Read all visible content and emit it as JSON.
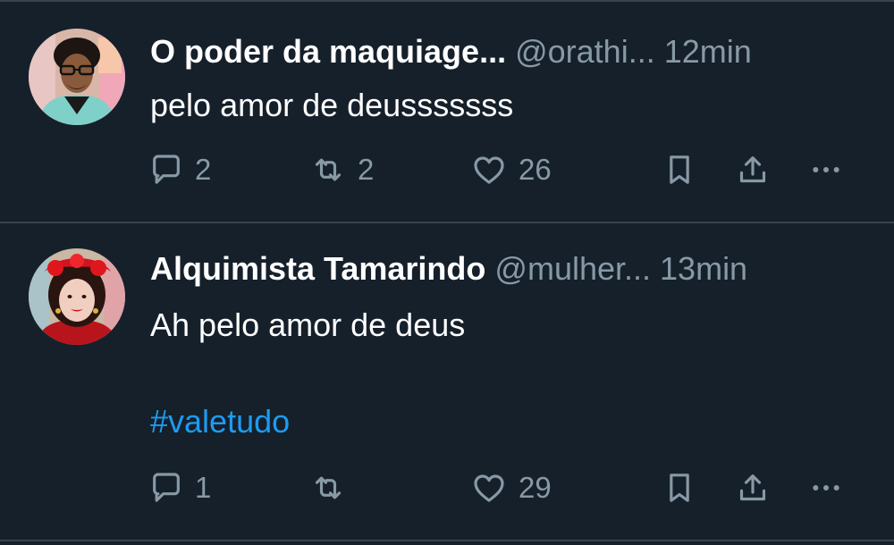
{
  "tweets": [
    {
      "author_name": "O poder da maquiage...",
      "handle": "@orathi...",
      "time": "12min",
      "text": "pelo amor de deusssssss",
      "hashtag": "",
      "replies": "2",
      "retweets": "2",
      "likes": "26",
      "avatar_icon": "avatar-man-glasses"
    },
    {
      "author_name": "Alquimista Tamarindo",
      "handle": "@mulher...",
      "time": "13min",
      "text": "Ah pelo amor de deus",
      "hashtag": "#valetudo",
      "replies": "1",
      "retweets": "",
      "likes": "29",
      "avatar_icon": "avatar-woman-red-headpiece"
    }
  ],
  "action_icons": [
    "reply-icon",
    "retweet-icon",
    "like-icon",
    "bookmark-icon",
    "share-icon",
    "more-icon"
  ],
  "colors": {
    "background": "#15202b",
    "divider": "#38444d",
    "primary_text": "#ffffff",
    "secondary_text": "#8899a6",
    "link": "#1d9bf0"
  }
}
